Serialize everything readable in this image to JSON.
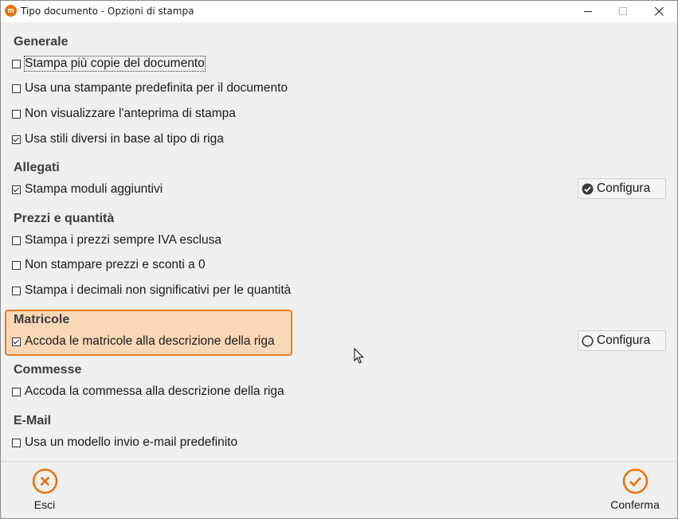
{
  "window": {
    "title": "Tipo documento - Opzioni di stampa",
    "app_icon_glyph": "m",
    "accent_color": "#e8740e",
    "highlight_fill": "#f9d8b7",
    "highlight_border": "#e5801c"
  },
  "sections": {
    "generale": {
      "title": "Generale",
      "options": [
        {
          "label": "Stampa più copie del documento",
          "checked": false,
          "focused": true
        },
        {
          "label": "Usa una stampante predefinita per il documento",
          "checked": false
        },
        {
          "label": "Non visualizzare l'anteprima di stampa",
          "checked": false
        },
        {
          "label": "Usa stili diversi in base al tipo di riga",
          "checked": true
        }
      ]
    },
    "allegati": {
      "title": "Allegati",
      "options": [
        {
          "label": "Stampa moduli aggiuntivi",
          "checked": true
        }
      ],
      "configure": {
        "label": "Configura",
        "icon": "check-circle-filled-icon"
      }
    },
    "prezzi": {
      "title": "Prezzi e quantità",
      "options": [
        {
          "label": "Stampa i prezzi sempre IVA esclusa",
          "checked": false
        },
        {
          "label": "Non stampare prezzi e sconti a 0",
          "checked": false
        },
        {
          "label": "Stampa i decimali non significativi per le quantità",
          "checked": false
        }
      ]
    },
    "matricole": {
      "title": "Matricole",
      "options": [
        {
          "label": "Accoda le matricole alla descrizione della riga",
          "checked": true
        }
      ],
      "configure": {
        "label": "Configura",
        "icon": "empty-circle-icon"
      }
    },
    "commesse": {
      "title": "Commesse",
      "options": [
        {
          "label": "Accoda la commessa alla descrizione della riga",
          "checked": false
        }
      ]
    },
    "email": {
      "title": "E-Mail",
      "options": [
        {
          "label": "Usa un modello invio e-mail predefinito",
          "checked": false
        }
      ]
    }
  },
  "footer": {
    "cancel_label": "Esci",
    "cancel_icon": "x-circle-icon",
    "confirm_label": "Conferma",
    "confirm_icon": "check-circle-icon"
  }
}
